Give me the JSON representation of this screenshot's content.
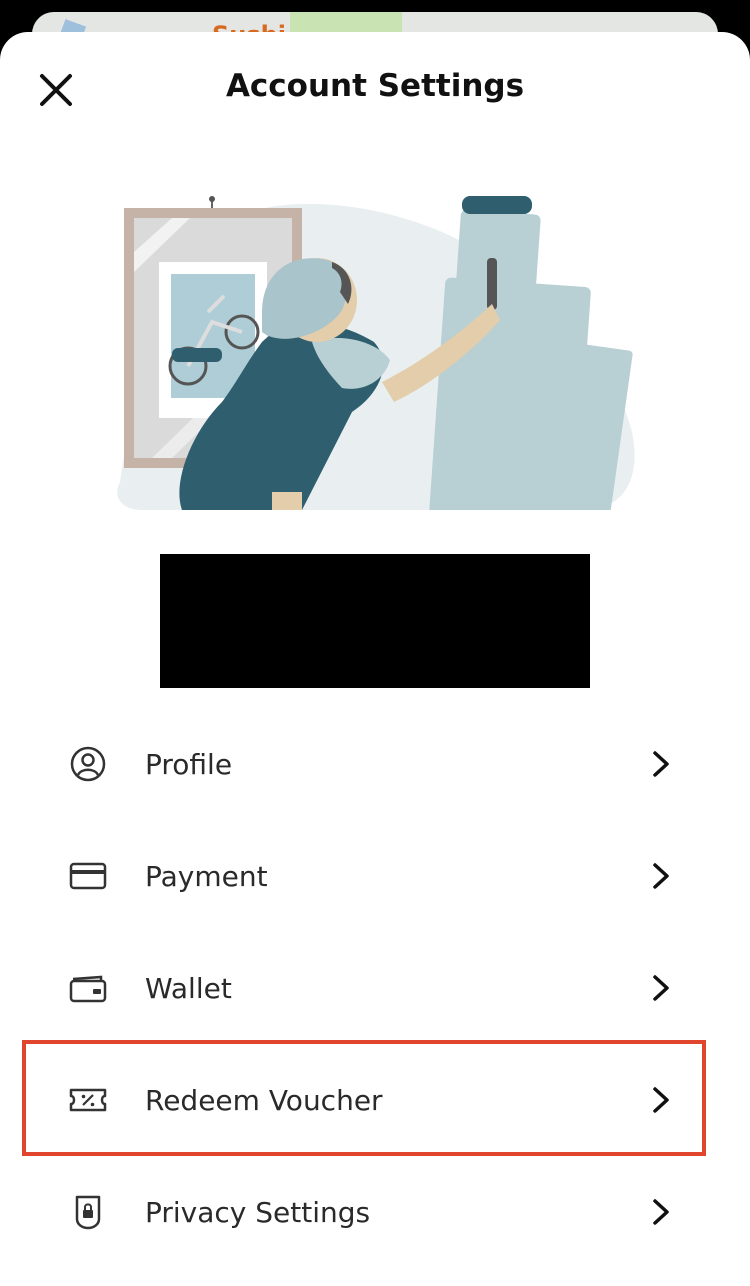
{
  "background_map": {
    "label": "Sushi"
  },
  "header": {
    "title": "Account Settings",
    "close_icon": "close-icon"
  },
  "illustration": {
    "description_icon": "illustration-painter-framing-picture"
  },
  "menu": {
    "items": [
      {
        "label": "Profile",
        "icon": "user-circle-icon"
      },
      {
        "label": "Payment",
        "icon": "credit-card-icon"
      },
      {
        "label": "Wallet",
        "icon": "wallet-icon"
      },
      {
        "label": "Redeem Voucher",
        "icon": "voucher-icon"
      },
      {
        "label": "Privacy Settings",
        "icon": "shield-lock-icon"
      }
    ]
  },
  "colors": {
    "highlight": "#e0452e",
    "illustration_teal": "#2f5f6f",
    "illustration_light": "#b8cfd4"
  }
}
